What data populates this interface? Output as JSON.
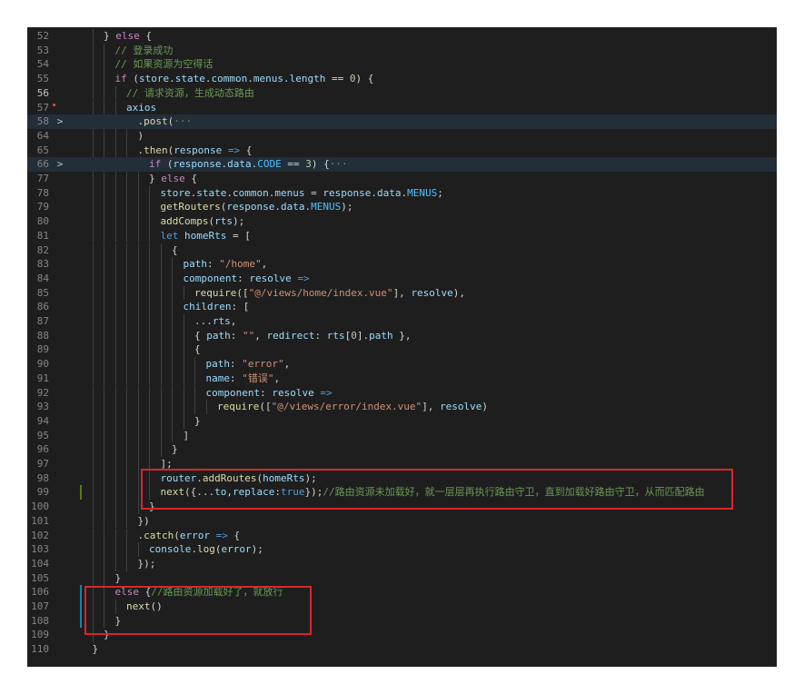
{
  "editor": {
    "lines": [
      {
        "n": "52",
        "indent": 2,
        "tokens": [
          [
            "txt",
            "} "
          ],
          [
            "kw",
            "else"
          ],
          [
            "txt",
            " {"
          ]
        ]
      },
      {
        "n": "53",
        "indent": 3,
        "tokens": [
          [
            "cm",
            "// 登录成功"
          ]
        ]
      },
      {
        "n": "54",
        "indent": 3,
        "tokens": [
          [
            "cm",
            "// 如果资源为空得话"
          ]
        ]
      },
      {
        "n": "55",
        "indent": 3,
        "tokens": [
          [
            "kw",
            "if"
          ],
          [
            "txt",
            " ("
          ],
          [
            "var",
            "store"
          ],
          [
            "txt",
            "."
          ],
          [
            "var",
            "state"
          ],
          [
            "txt",
            "."
          ],
          [
            "var",
            "common"
          ],
          [
            "txt",
            "."
          ],
          [
            "var",
            "menus"
          ],
          [
            "txt",
            "."
          ],
          [
            "var",
            "length"
          ],
          [
            "txt",
            " == "
          ],
          [
            "num",
            "0"
          ],
          [
            "txt",
            ") {"
          ]
        ]
      },
      {
        "n": "56",
        "indent": 4,
        "cur": true,
        "tokens": [
          [
            "cm",
            "// 请求资源，生成动态路由"
          ]
        ]
      },
      {
        "n": "57",
        "indent": 4,
        "tokens": [
          [
            "var",
            "axios"
          ]
        ]
      },
      {
        "n": "58",
        "indent": 5,
        "fold": ">",
        "hl": true,
        "tokens": [
          [
            "txt",
            "."
          ],
          [
            "fn",
            "post"
          ],
          [
            "txt",
            "("
          ],
          [
            "cm",
            "···"
          ]
        ]
      },
      {
        "n": "64",
        "indent": 5,
        "tokens": [
          [
            "txt",
            ")"
          ]
        ]
      },
      {
        "n": "65",
        "indent": 5,
        "tokens": [
          [
            "txt",
            "."
          ],
          [
            "fn",
            "then"
          ],
          [
            "txt",
            "("
          ],
          [
            "var",
            "response"
          ],
          [
            "k2",
            " =>"
          ],
          [
            "txt",
            " {"
          ]
        ]
      },
      {
        "n": "66",
        "indent": 6,
        "fold": ">",
        "hl": true,
        "tokens": [
          [
            "kw",
            "if"
          ],
          [
            "txt",
            " ("
          ],
          [
            "var",
            "response"
          ],
          [
            "txt",
            "."
          ],
          [
            "var",
            "data"
          ],
          [
            "txt",
            "."
          ],
          [
            "const",
            "CODE"
          ],
          [
            "txt",
            " == "
          ],
          [
            "num",
            "3"
          ],
          [
            "txt",
            ") {"
          ],
          [
            "cm",
            "···"
          ]
        ]
      },
      {
        "n": "77",
        "indent": 6,
        "tokens": [
          [
            "txt",
            "} "
          ],
          [
            "kw",
            "else"
          ],
          [
            "txt",
            " {"
          ]
        ]
      },
      {
        "n": "78",
        "indent": 7,
        "tokens": [
          [
            "var",
            "store"
          ],
          [
            "txt",
            "."
          ],
          [
            "var",
            "state"
          ],
          [
            "txt",
            "."
          ],
          [
            "var",
            "common"
          ],
          [
            "txt",
            "."
          ],
          [
            "var",
            "menus"
          ],
          [
            "txt",
            " = "
          ],
          [
            "var",
            "response"
          ],
          [
            "txt",
            "."
          ],
          [
            "var",
            "data"
          ],
          [
            "txt",
            "."
          ],
          [
            "const",
            "MENUS"
          ],
          [
            "txt",
            ";"
          ]
        ]
      },
      {
        "n": "79",
        "indent": 7,
        "tokens": [
          [
            "fn",
            "getRouters"
          ],
          [
            "txt",
            "("
          ],
          [
            "var",
            "response"
          ],
          [
            "txt",
            "."
          ],
          [
            "var",
            "data"
          ],
          [
            "txt",
            "."
          ],
          [
            "const",
            "MENUS"
          ],
          [
            "txt",
            ");"
          ]
        ]
      },
      {
        "n": "80",
        "indent": 7,
        "tokens": [
          [
            "fn",
            "addComps"
          ],
          [
            "txt",
            "("
          ],
          [
            "var",
            "rts"
          ],
          [
            "txt",
            ");"
          ]
        ]
      },
      {
        "n": "81",
        "indent": 7,
        "tokens": [
          [
            "k2",
            "let"
          ],
          [
            "txt",
            " "
          ],
          [
            "var",
            "homeRts"
          ],
          [
            "txt",
            " = ["
          ]
        ]
      },
      {
        "n": "82",
        "indent": 8,
        "tokens": [
          [
            "txt",
            "{"
          ]
        ]
      },
      {
        "n": "83",
        "indent": 9,
        "tokens": [
          [
            "var",
            "path"
          ],
          [
            "txt",
            ": "
          ],
          [
            "str",
            "\"/home\""
          ],
          [
            "txt",
            ","
          ]
        ]
      },
      {
        "n": "84",
        "indent": 9,
        "tokens": [
          [
            "var",
            "component"
          ],
          [
            "txt",
            ": "
          ],
          [
            "var",
            "resolve"
          ],
          [
            "k2",
            " =>"
          ]
        ]
      },
      {
        "n": "85",
        "indent": 10,
        "tokens": [
          [
            "fn",
            "require"
          ],
          [
            "txt",
            "(["
          ],
          [
            "str",
            "\"@/views/home/index.vue\""
          ],
          [
            "txt",
            "], "
          ],
          [
            "var",
            "resolve"
          ],
          [
            "txt",
            "),"
          ]
        ]
      },
      {
        "n": "86",
        "indent": 9,
        "tokens": [
          [
            "var",
            "children"
          ],
          [
            "txt",
            ": ["
          ]
        ]
      },
      {
        "n": "87",
        "indent": 10,
        "tokens": [
          [
            "txt",
            "..."
          ],
          [
            "var",
            "rts"
          ],
          [
            "txt",
            ","
          ]
        ]
      },
      {
        "n": "88",
        "indent": 10,
        "tokens": [
          [
            "txt",
            "{ "
          ],
          [
            "var",
            "path"
          ],
          [
            "txt",
            ": "
          ],
          [
            "str",
            "\"\""
          ],
          [
            "txt",
            ", "
          ],
          [
            "var",
            "redirect"
          ],
          [
            "txt",
            ": "
          ],
          [
            "var",
            "rts"
          ],
          [
            "txt",
            "["
          ],
          [
            "num",
            "0"
          ],
          [
            "txt",
            "]."
          ],
          [
            "var",
            "path"
          ],
          [
            "txt",
            " },"
          ]
        ]
      },
      {
        "n": "89",
        "indent": 10,
        "tokens": [
          [
            "txt",
            "{"
          ]
        ]
      },
      {
        "n": "90",
        "indent": 11,
        "tokens": [
          [
            "var",
            "path"
          ],
          [
            "txt",
            ": "
          ],
          [
            "str",
            "\"error\""
          ],
          [
            "txt",
            ","
          ]
        ]
      },
      {
        "n": "91",
        "indent": 11,
        "tokens": [
          [
            "var",
            "name"
          ],
          [
            "txt",
            ": "
          ],
          [
            "str",
            "\"错误\""
          ],
          [
            "txt",
            ","
          ]
        ]
      },
      {
        "n": "92",
        "indent": 11,
        "tokens": [
          [
            "var",
            "component"
          ],
          [
            "txt",
            ": "
          ],
          [
            "var",
            "resolve"
          ],
          [
            "k2",
            " =>"
          ]
        ]
      },
      {
        "n": "93",
        "indent": 12,
        "tokens": [
          [
            "fn",
            "require"
          ],
          [
            "txt",
            "(["
          ],
          [
            "str",
            "\"@/views/error/index.vue\""
          ],
          [
            "txt",
            "], "
          ],
          [
            "var",
            "resolve"
          ],
          [
            "txt",
            ")"
          ]
        ]
      },
      {
        "n": "94",
        "indent": 10,
        "tokens": [
          [
            "txt",
            "}"
          ]
        ]
      },
      {
        "n": "95",
        "indent": 9,
        "tokens": [
          [
            "txt",
            "]"
          ]
        ]
      },
      {
        "n": "96",
        "indent": 8,
        "tokens": [
          [
            "txt",
            "}"
          ]
        ]
      },
      {
        "n": "97",
        "indent": 7,
        "tokens": [
          [
            "txt",
            "];"
          ]
        ]
      },
      {
        "n": "98",
        "indent": 7,
        "tokens": [
          [
            "var",
            "router"
          ],
          [
            "txt",
            "."
          ],
          [
            "fn",
            "addRoutes"
          ],
          [
            "txt",
            "("
          ],
          [
            "var",
            "homeRts"
          ],
          [
            "txt",
            ");"
          ]
        ]
      },
      {
        "n": "99",
        "indent": 7,
        "mark": "#587c0c",
        "tokens": [
          [
            "fn",
            "next"
          ],
          [
            "txt",
            "({..."
          ],
          [
            "var",
            "to"
          ],
          [
            "txt",
            ","
          ],
          [
            "var",
            "replace"
          ],
          [
            "txt",
            ":"
          ],
          [
            "k2",
            "true"
          ],
          [
            "txt",
            "});"
          ],
          [
            "cm",
            "//路由资源未加载好，就一层层再执行路由守卫，直到加载好路由守卫，从而匹配路由"
          ]
        ]
      },
      {
        "n": "100",
        "indent": 6,
        "tokens": [
          [
            "txt",
            "}"
          ]
        ]
      },
      {
        "n": "101",
        "indent": 5,
        "tokens": [
          [
            "txt",
            "})"
          ]
        ]
      },
      {
        "n": "102",
        "indent": 5,
        "tokens": [
          [
            "txt",
            "."
          ],
          [
            "fn",
            "catch"
          ],
          [
            "txt",
            "("
          ],
          [
            "var",
            "error"
          ],
          [
            "k2",
            " =>"
          ],
          [
            "txt",
            " {"
          ]
        ]
      },
      {
        "n": "103",
        "indent": 6,
        "tokens": [
          [
            "var",
            "console"
          ],
          [
            "txt",
            "."
          ],
          [
            "fn",
            "log"
          ],
          [
            "txt",
            "("
          ],
          [
            "var",
            "error"
          ],
          [
            "txt",
            ");"
          ]
        ]
      },
      {
        "n": "104",
        "indent": 5,
        "tokens": [
          [
            "txt",
            "});"
          ]
        ]
      },
      {
        "n": "105",
        "indent": 3,
        "tokens": [
          [
            "txt",
            "}"
          ]
        ]
      },
      {
        "n": "106",
        "indent": 3,
        "mark": "#1b81a8",
        "tokens": [
          [
            "kw",
            "else"
          ],
          [
            "txt",
            " {"
          ],
          [
            "cm",
            "//路由资源加载好了，就放行"
          ]
        ]
      },
      {
        "n": "107",
        "indent": 4,
        "mark": "#1b81a8",
        "tokens": [
          [
            "fn",
            "next"
          ],
          [
            "txt",
            "()"
          ]
        ]
      },
      {
        "n": "108",
        "indent": 3,
        "mark": "#1b81a8",
        "tokens": [
          [
            "txt",
            "}"
          ]
        ]
      },
      {
        "n": "109",
        "indent": 2,
        "tokens": [
          [
            "txt",
            "}"
          ]
        ]
      },
      {
        "n": "110",
        "indent": 1,
        "tokens": [
          [
            "txt",
            "}"
          ]
        ]
      }
    ]
  },
  "colors": {
    "background": "#1e1e1e",
    "annotation_box": "#d9262b"
  }
}
